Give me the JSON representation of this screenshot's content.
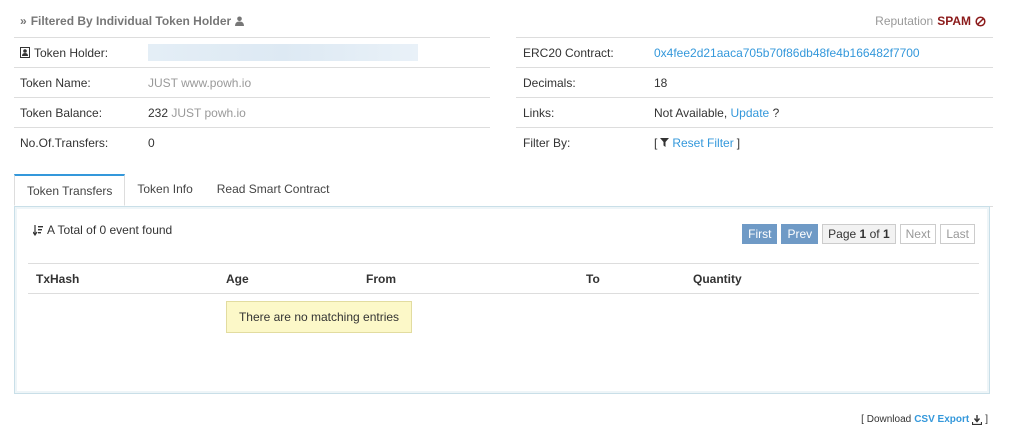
{
  "header": {
    "prefix": "»",
    "title": "Filtered By Individual Token Holder",
    "icon": "user-icon"
  },
  "reputation": {
    "label": "Reputation",
    "value": "SPAM",
    "icon": "ban-icon",
    "color": "#8b1a1a"
  },
  "left_info": {
    "holder_label": "Token Holder:",
    "name_label": "Token Name:",
    "name_value": "JUST www.powh.io",
    "balance_label": "Token Balance:",
    "balance_amount": "232",
    "balance_unit": "JUST powh.io",
    "transfers_label": "No.Of.Transfers:",
    "transfers_value": "0"
  },
  "right_info": {
    "contract_label": "ERC20 Contract:",
    "contract_value": "0x4fee2d21aaca705b70f86db48fe4b166482f7700",
    "decimals_label": "Decimals:",
    "decimals_value": "18",
    "links_label": "Links:",
    "links_not": "Not Available,",
    "links_update": "Update",
    "links_q": "?",
    "filter_label": "Filter By:",
    "filter_open": "[",
    "filter_link": "Reset Filter",
    "filter_close": "]"
  },
  "tabs": [
    "Token Transfers",
    "Token Info",
    "Read Smart Contract"
  ],
  "transfers": {
    "total_text": "A Total of 0 event found",
    "pager": {
      "first": "First",
      "prev": "Prev",
      "page_word": "Page",
      "page_num": "1",
      "of_word": "of",
      "of_num": "1",
      "next": "Next",
      "last": "Last"
    },
    "columns": [
      "TxHash",
      "Age",
      "From",
      "To",
      "Quantity"
    ],
    "empty_text": "There are no matching entries"
  },
  "footer": {
    "open": "[ Download",
    "csv": "CSV Export",
    "close": "]"
  },
  "colors": {
    "link": "#3498db",
    "pager_active": "#6f9ac6",
    "empty_bg": "#fcf8c8"
  }
}
